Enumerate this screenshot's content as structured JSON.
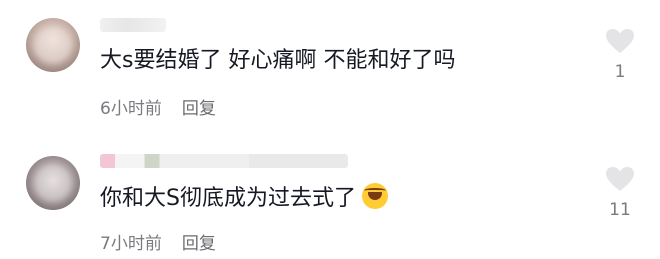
{
  "comments": [
    {
      "text": "大s要结婚了 好心痛啊 不能和好了吗",
      "time": "6小时前",
      "reply_label": "回复",
      "like_count": "1"
    },
    {
      "text": "你和大S彻底成为过去式了",
      "emoji": "crying-laughing-emoji",
      "time": "7小时前",
      "reply_label": "回复",
      "like_count": "11"
    }
  ],
  "icons": {
    "like": "heart-icon"
  },
  "colors": {
    "text": "#161823",
    "meta": "#7a7a80",
    "heart": "#e4e4e6"
  }
}
